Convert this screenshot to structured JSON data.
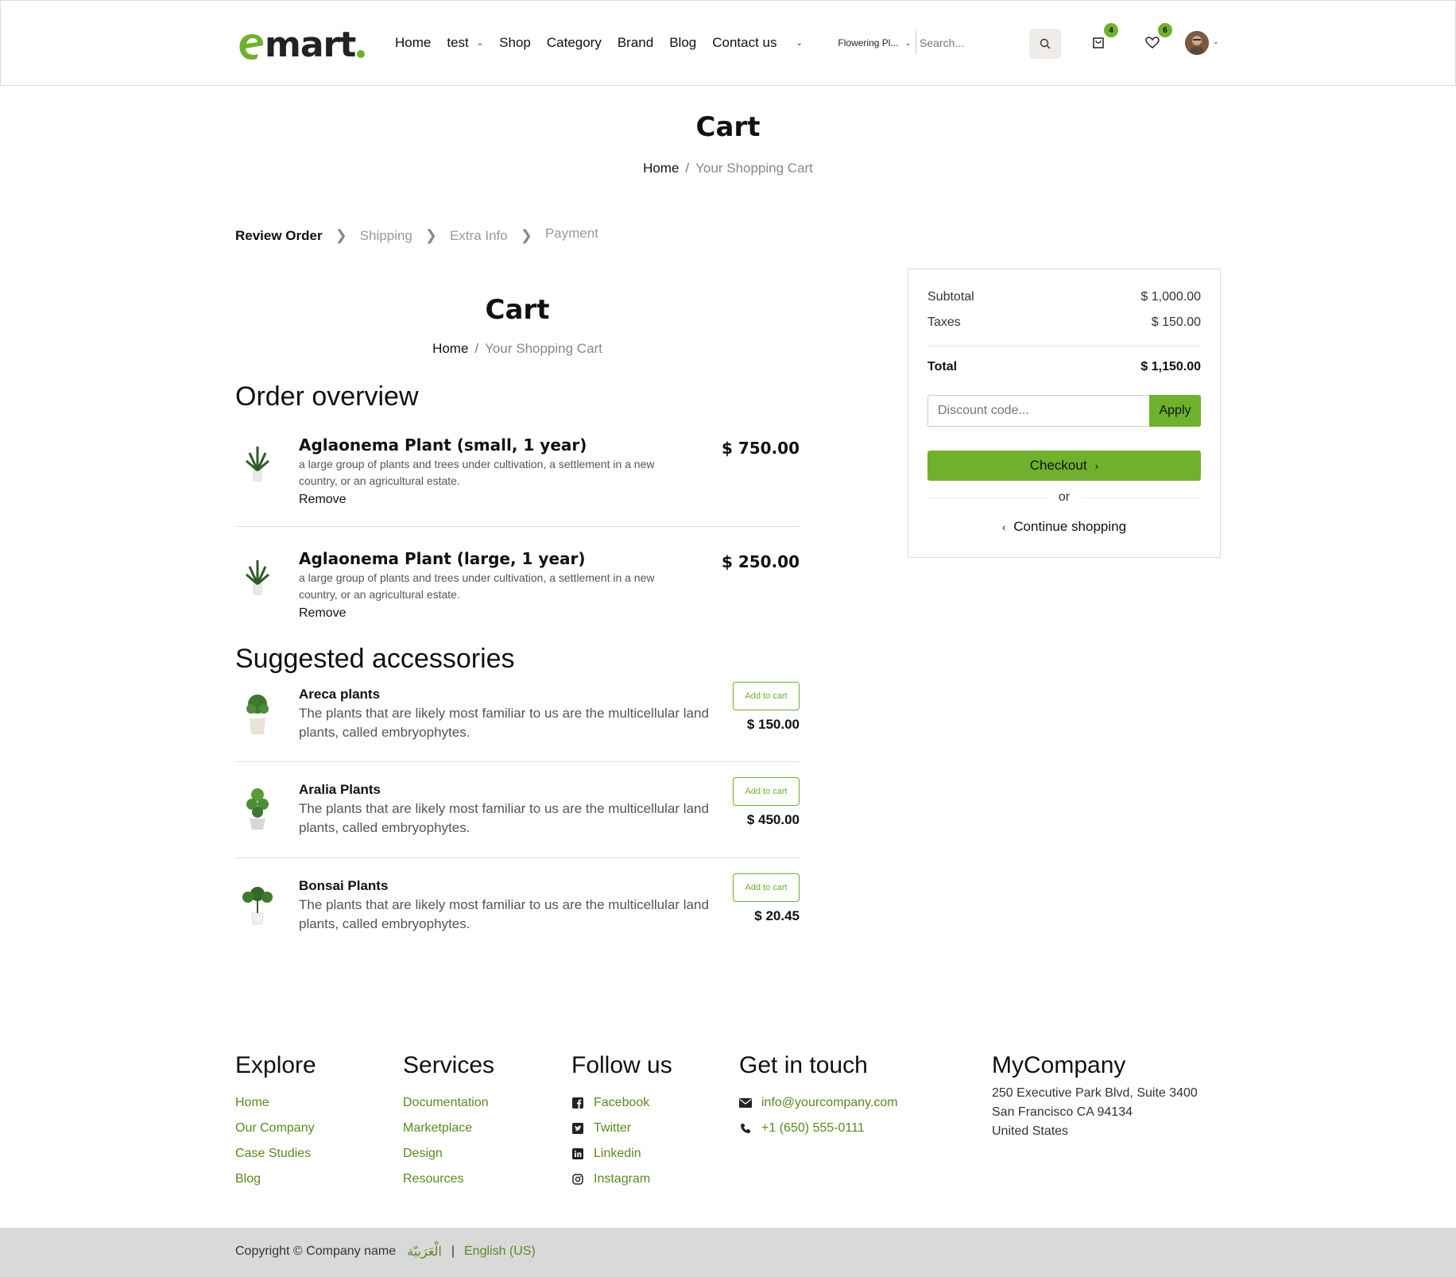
{
  "header": {
    "logo_text": "mart",
    "nav": [
      "Home",
      "test",
      "Shop",
      "Category",
      "Brand",
      "Blog",
      "Contact us"
    ],
    "search_category": "Flowering Pl...",
    "search_placeholder": "Search...",
    "cart_count": "4",
    "wishlist_count": "6"
  },
  "page": {
    "title": "Cart",
    "breadcrumb_home": "Home",
    "breadcrumb_sep": "/",
    "breadcrumb_current": "Your Shopping Cart"
  },
  "steps": [
    "Review Order",
    "Shipping",
    "Extra Info",
    "Payment"
  ],
  "order": {
    "heading": "Order overview",
    "lines": [
      {
        "name": "Aglaonema Plant (small, 1 year)",
        "description": "a large group of plants and trees under cultivation, a settlement in a new country, or an agricultural estate.",
        "remove": "Remove",
        "price": "$ 750.00"
      },
      {
        "name": "Aglaonema Plant (large, 1 year)",
        "description": "a large group of plants and trees under cultivation, a settlement in a new country, or an agricultural estate.",
        "remove": "Remove",
        "price": "$ 250.00"
      }
    ]
  },
  "accessories": {
    "heading": "Suggested accessories",
    "add_label": "Add to cart",
    "items": [
      {
        "name": "Areca plants",
        "description": "The plants that are likely most familiar to us are the multicellular land plants, called embryophytes.",
        "price": "$ 150.00"
      },
      {
        "name": "Aralia Plants",
        "description": "The plants that are likely most familiar to us are the multicellular land plants, called embryophytes.",
        "price": "$ 450.00"
      },
      {
        "name": "Bonsai Plants",
        "description": "The plants that are likely most familiar to us are the multicellular land plants, called embryophytes.",
        "price": "$ 20.45"
      }
    ]
  },
  "summary": {
    "subtotal_label": "Subtotal",
    "subtotal": "$ 1,000.00",
    "taxes_label": "Taxes",
    "taxes": "$ 150.00",
    "total_label": "Total",
    "total": "$ 1,150.00",
    "discount_placeholder": "Discount code...",
    "apply": "Apply",
    "checkout": "Checkout",
    "or": "or",
    "continue": "Continue shopping"
  },
  "footer": {
    "explore": {
      "title": "Explore",
      "links": [
        "Home",
        "Our Company",
        "Case Studies",
        "Blog"
      ]
    },
    "services": {
      "title": "Services",
      "links": [
        "Documentation",
        "Marketplace",
        "Design",
        "Resources"
      ]
    },
    "follow": {
      "title": "Follow us",
      "links": [
        "Facebook",
        "Twitter",
        "Linkedin",
        "Instagram"
      ]
    },
    "contact": {
      "title": "Get in touch",
      "email": "info@yourcompany.com",
      "phone": "+1 (650) 555-0111"
    },
    "company": {
      "title": "MyCompany",
      "address": [
        "250 Executive Park Blvd, Suite 3400",
        "San Francisco CA 94134",
        "United States"
      ]
    },
    "copyright": "Copyright © Company name",
    "lang_ar": "الْعَرَبيّة",
    "lang_sep": "|",
    "lang_en": "English (US)"
  },
  "colors": {
    "accent": "#6fb12d",
    "link": "#5a8a1f",
    "odoo_corner": "#714b67"
  }
}
